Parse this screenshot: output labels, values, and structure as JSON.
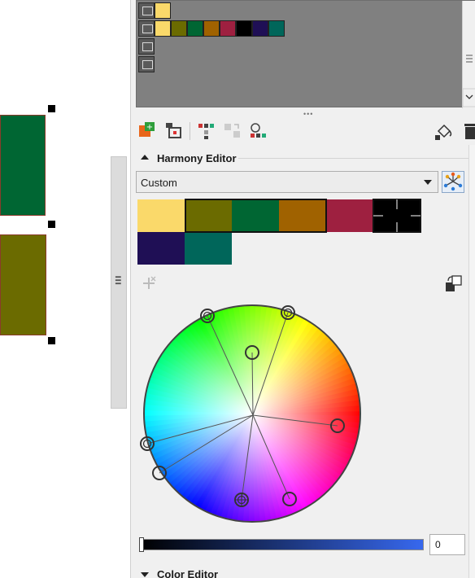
{
  "colors": {
    "shape_green": "#006633",
    "shape_olive": "#6b6b00",
    "palette_bg": "#808080",
    "docker_bg": "#f0f0f0",
    "accent": "#3768ee"
  },
  "palette_viewer": {
    "rows": [
      {
        "swatches": [
          "#fad96a"
        ]
      },
      {
        "swatches": [
          "#fad96a",
          "#6b6b00",
          "#006633",
          "#a06200",
          "#9e2040",
          "#000000",
          "#1f0f55",
          "#00665a"
        ]
      },
      {
        "swatches": []
      },
      {
        "swatches": []
      }
    ]
  },
  "toolbar": {
    "icons": [
      "new-harmony-icon",
      "add-from-selection-icon",
      "color-grid-icon",
      "disabled-transform-icon",
      "palette-share-icon",
      "fill-bucket-icon",
      "delete-icon"
    ]
  },
  "harmony_editor": {
    "title": "Harmony Editor",
    "mode": {
      "selected": "Custom"
    },
    "swatches_row1": [
      "#fad96a",
      "#6b6b00",
      "#006633",
      "#a06200",
      "#9e2040",
      "#000000"
    ],
    "swatches_row2": [
      "#1f0f55",
      "#00665a"
    ],
    "brightness_value": "0"
  },
  "color_editor": {
    "title": "Color Editor"
  }
}
